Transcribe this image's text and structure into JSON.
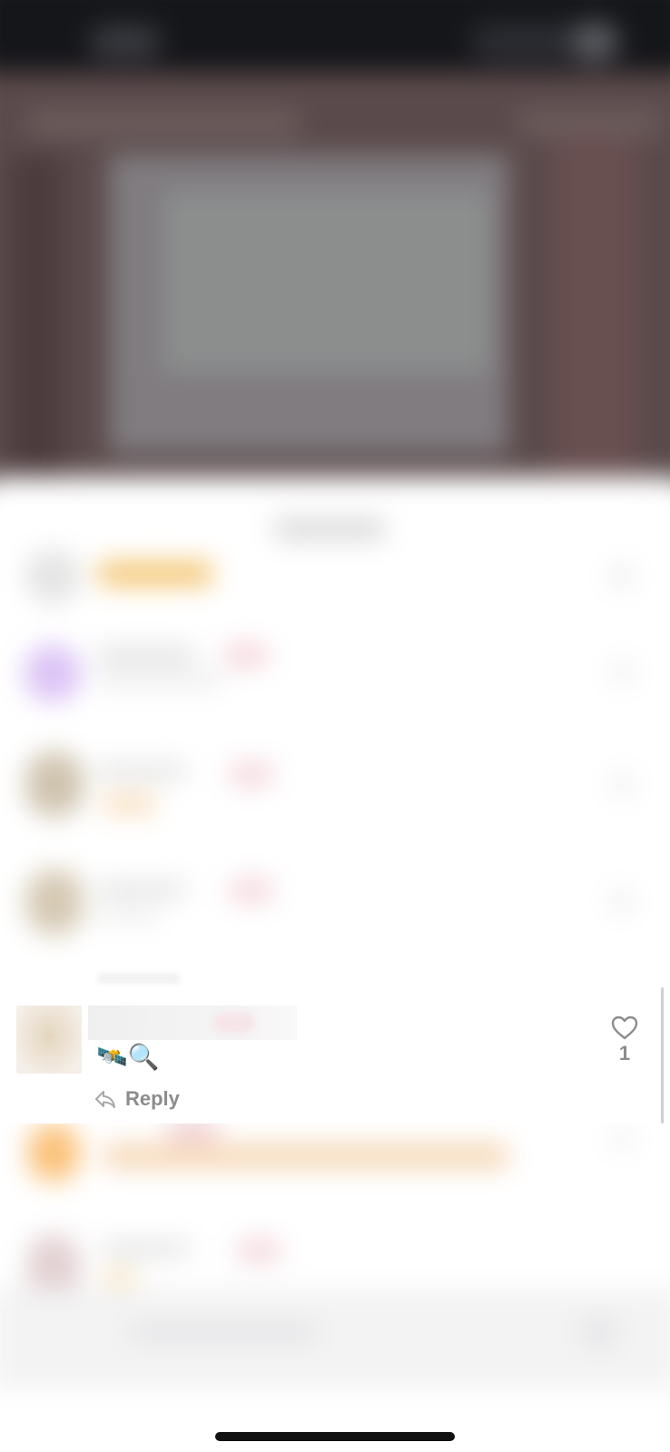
{
  "focused_comment": {
    "emoji": "🛰️🔍",
    "reply_label": "Reply",
    "like_count": "1"
  },
  "colors": {
    "top_bar": "#15161a",
    "video_bg": "#5a4c4c",
    "sheet_bg": "#ffffff",
    "secondary_text": "#8c8c8c",
    "home_indicator": "#111111"
  },
  "icons": {
    "like": "heart-outline-icon",
    "reply": "reply-arrow-icon"
  }
}
